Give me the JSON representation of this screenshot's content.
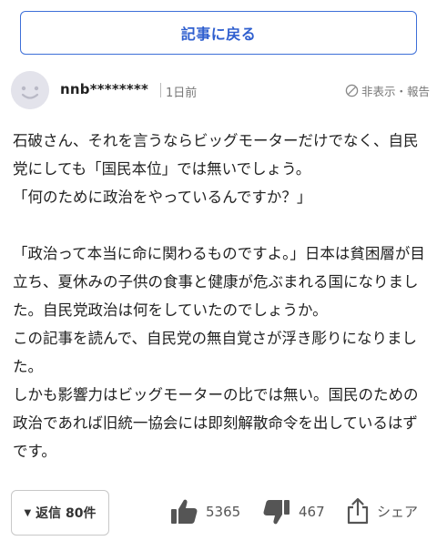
{
  "nav": {
    "back_label": "記事に戻る"
  },
  "comment": {
    "username": "nnb********",
    "time": "1日前",
    "report_label": "非表示・報告",
    "paragraphs": [
      "石破さん、それを言うならビッグモーターだけでなく、自民党にしても「国民本位」では無いでしょう。\n「何のために政治をやっているんですか？」",
      "",
      "「政治って本当に命に関わるものですよ。」日本は貧困層が目立ち、夏休みの子供の食事と健康が危ぶまれる国になりました。自民党政治は何をしていたのでしょうか。\nこの記事を読んで、自民党の無自覚さが浮き彫りになりました。\nしかも影響力はビッグモーターの比では無い。国民のための政治であれば旧統一協会には即刻解散命令を出しているはずです。"
    ]
  },
  "footer": {
    "replies_label": "返信 80件",
    "like_count": "5365",
    "dislike_count": "467",
    "share_label": "シェア"
  },
  "colors": {
    "accent": "#3d6fd8",
    "text": "#222222",
    "muted": "#777777",
    "icon": "#555555"
  },
  "icons": {
    "avatar": "smiley-face-icon",
    "report": "prohibited-icon",
    "replies": "triangle-down-icon",
    "like": "thumbs-up-icon",
    "dislike": "thumbs-down-icon",
    "share": "share-icon"
  }
}
